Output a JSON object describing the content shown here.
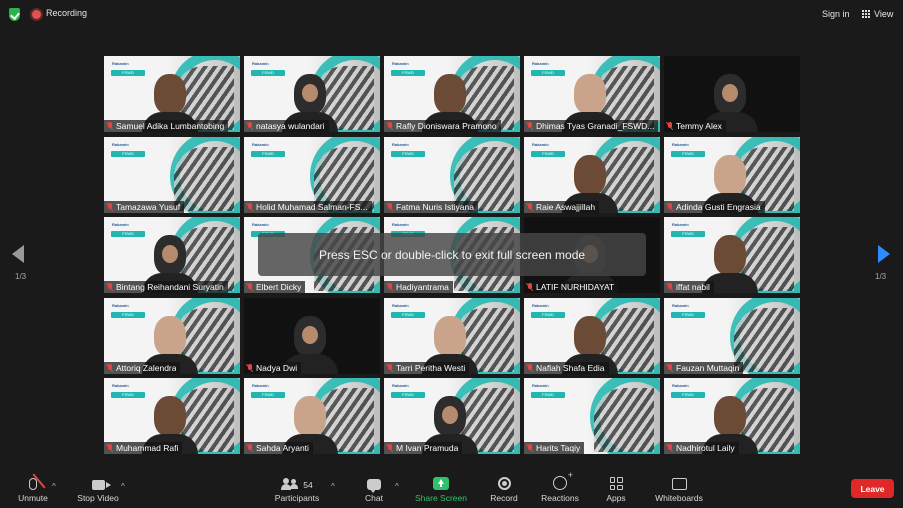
{
  "topbar": {
    "recording_label": "Recording",
    "signin_label": "Sign in",
    "view_label": "View"
  },
  "pagination": {
    "left": "1/3",
    "right": "1/3"
  },
  "banner": {
    "text": "Press ESC or double-click to exit full screen mode"
  },
  "slide": {
    "logo": "Rakamin",
    "pill": "FSWD"
  },
  "participants": [
    {
      "name": "Samuel Adika Lumbantobing"
    },
    {
      "name": "natasya wulandari"
    },
    {
      "name": "Rafly Dioniswara Pramono"
    },
    {
      "name": "Dhimas Tyas Granadi_FSWD..."
    },
    {
      "name": "Temmy Alex"
    },
    {
      "name": "Tamazawa Yusuf"
    },
    {
      "name": "Holid Muhamad Salman-FS..."
    },
    {
      "name": "Fatma Nuris Istiyana"
    },
    {
      "name": "Raie Aswajjillah"
    },
    {
      "name": "Adinda Gusti Engrasia"
    },
    {
      "name": "Bintang Reihandani Suryatin"
    },
    {
      "name": "Elbert Dicky"
    },
    {
      "name": "Hadiyantrama"
    },
    {
      "name": "LATIF NURHIDAYAT"
    },
    {
      "name": "iffat nabil"
    },
    {
      "name": "Attoriq Zalendra"
    },
    {
      "name": "Nadya Dwi"
    },
    {
      "name": "Tarri Peritha Westi"
    },
    {
      "name": "Naflah Shafa Edia"
    },
    {
      "name": "Fauzan Muttaqin"
    },
    {
      "name": "Muhammad Rafi"
    },
    {
      "name": "Sahda Aryanti"
    },
    {
      "name": "M Ivan Pramuda"
    },
    {
      "name": "Harits Taqiy"
    },
    {
      "name": "Nadhirotul Laily"
    }
  ],
  "toolbar": {
    "unmute": "Unmute",
    "stop_video": "Stop Video",
    "participants": "Participants",
    "participants_count": "54",
    "chat": "Chat",
    "share_screen": "Share Screen",
    "record": "Record",
    "reactions": "Reactions",
    "apps": "Apps",
    "whiteboards": "Whiteboards",
    "leave": "Leave"
  },
  "colors": {
    "active_speaker": "#d8e64a",
    "share_green": "#30c26a",
    "leave_red": "#e02828",
    "muted_red": "#e04646",
    "accent_blue": "#2d8cff"
  }
}
